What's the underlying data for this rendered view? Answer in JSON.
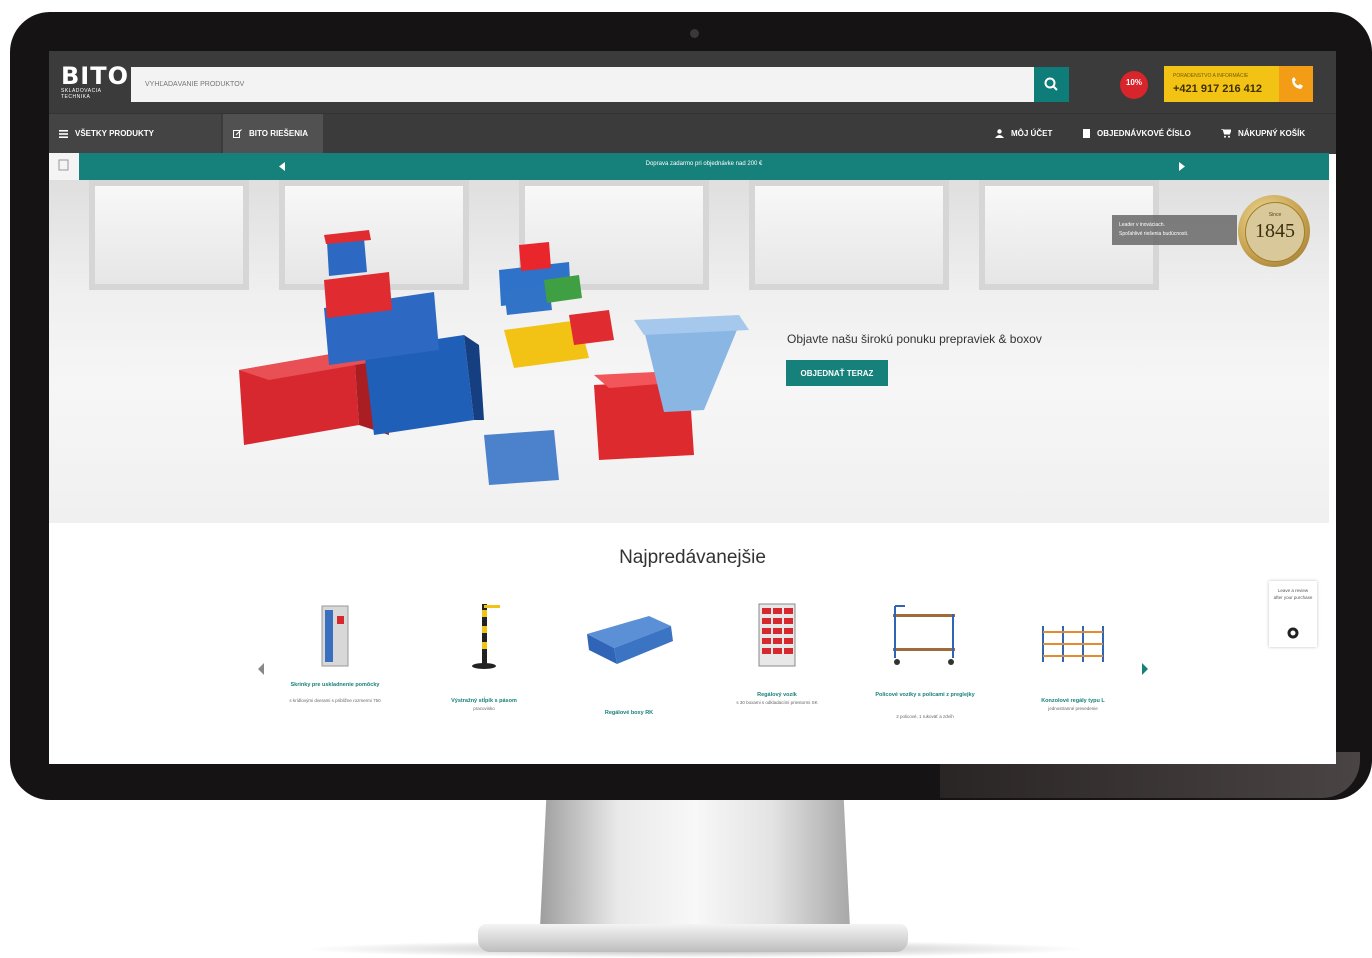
{
  "header": {
    "logo": {
      "main": "BITO",
      "sub": "SKLADOVACIA TECHNIKA"
    },
    "search": {
      "placeholder": "VYHĽADÁVANIE PRODUKTOV"
    },
    "discount_badge": "10%",
    "phone": {
      "label": "PORADENSTVO A INFORMÁCIE",
      "number": "+421 917 216 412"
    }
  },
  "nav": {
    "all_products": "VŠETKY PRODUKTY",
    "solutions": "BITO RIEŠENIA",
    "my_account": "MÔJ ÚČET",
    "order_number": "OBJEDNÁVKOVÉ ČÍSLO",
    "cart": "NÁKUPNÝ KOŠÍK"
  },
  "promo": {
    "text": "Doprava zadarmo pri objednávke nad 200 €"
  },
  "hero": {
    "heading": "Objavte našu širokú ponuku prepraviek & boxov",
    "cta": "OBJEDNAŤ TERAZ",
    "leader_line1": "Leader v inováciach.",
    "leader_line2": "Spoľahlivé riešenia budúcnosti.",
    "seal_small": "Since",
    "seal_year": "1845"
  },
  "bestsellers": {
    "title": "Najpredávanejšie",
    "products": [
      {
        "name": "Skrinky pre uskladnenie pomôcky",
        "sub": "s krídlovými dverami s približne rozmermi 750"
      },
      {
        "name": "Výstražný stĺpik s pásom",
        "sub": "pracovisko"
      },
      {
        "name": "Regálové boxy RK",
        "sub": ""
      },
      {
        "name": "Regálový vozík",
        "sub": "s 30 boxami s odkladacími priestormi SK"
      },
      {
        "name": "Policové vozíky s policami z preglejky",
        "sub": "2 policové, 1 rukoväť a zdvíh"
      },
      {
        "name": "Konzolové regály typu L",
        "sub": "jednostranné prevedenie"
      }
    ]
  },
  "chat_widget": {
    "text": "Leave a review after your purchase"
  },
  "colors": {
    "teal": "#16807b",
    "header": "#3b3b3b",
    "yellow": "#f2c314",
    "orange": "#f39c16",
    "red": "#d8242b"
  },
  "icons": [
    "search-icon",
    "menu-icon",
    "edit-icon",
    "user-icon",
    "document-icon",
    "cart-icon",
    "phone-icon",
    "chevron-left-icon",
    "chevron-right-icon"
  ]
}
